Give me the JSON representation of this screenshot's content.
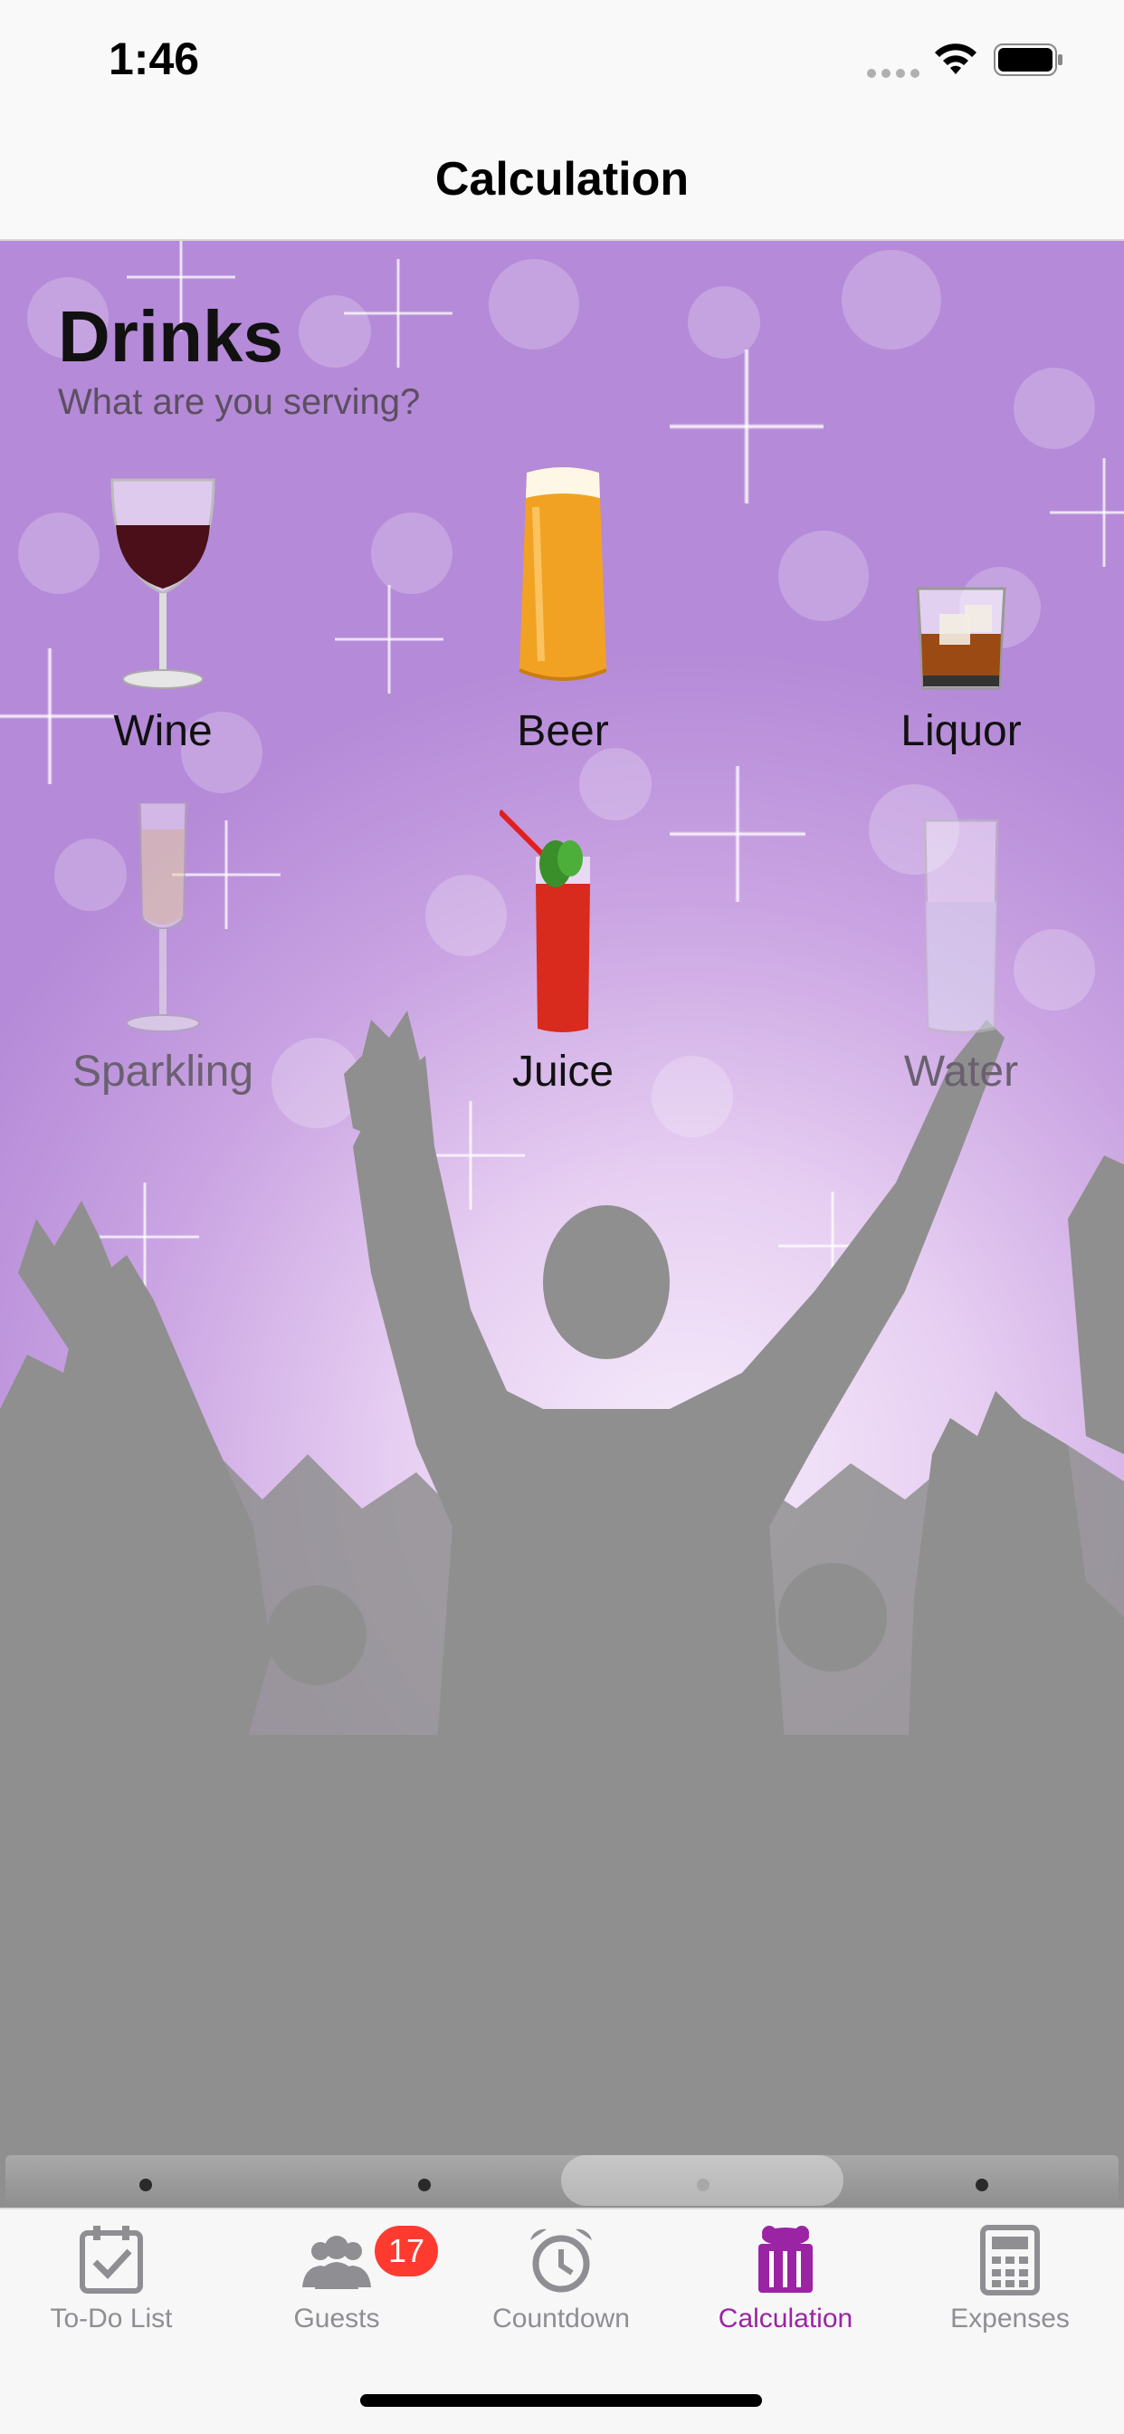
{
  "status_bar": {
    "time": "1:46"
  },
  "nav": {
    "title": "Calculation"
  },
  "section": {
    "title": "Drinks",
    "subtitle": "What are you serving?"
  },
  "drinks": [
    {
      "label": "Wine",
      "icon": "wine-glass-icon",
      "selected": true
    },
    {
      "label": "Beer",
      "icon": "beer-glass-icon",
      "selected": true
    },
    {
      "label": "Liquor",
      "icon": "liquor-glass-icon",
      "selected": true
    },
    {
      "label": "Sparkling",
      "icon": "champagne-flute-icon",
      "selected": false
    },
    {
      "label": "Juice",
      "icon": "juice-glass-icon",
      "selected": true
    },
    {
      "label": "Water",
      "icon": "water-glass-icon",
      "selected": false
    }
  ],
  "pager": {
    "page_count": 4,
    "current_page": 3
  },
  "tabs": [
    {
      "label": "To-Do List",
      "icon": "checklist-icon"
    },
    {
      "label": "Guests",
      "icon": "guests-icon",
      "badge": "17"
    },
    {
      "label": "Countdown",
      "icon": "alarm-clock-icon"
    },
    {
      "label": "Calculation",
      "icon": "cake-icon",
      "selected": true
    },
    {
      "label": "Expenses",
      "icon": "calculator-icon"
    }
  ],
  "colors": {
    "accent": "#9b24a4",
    "badge": "#ff3b30",
    "tab_inactive": "#8e8e93",
    "background_purple": "#c9a3e2"
  }
}
